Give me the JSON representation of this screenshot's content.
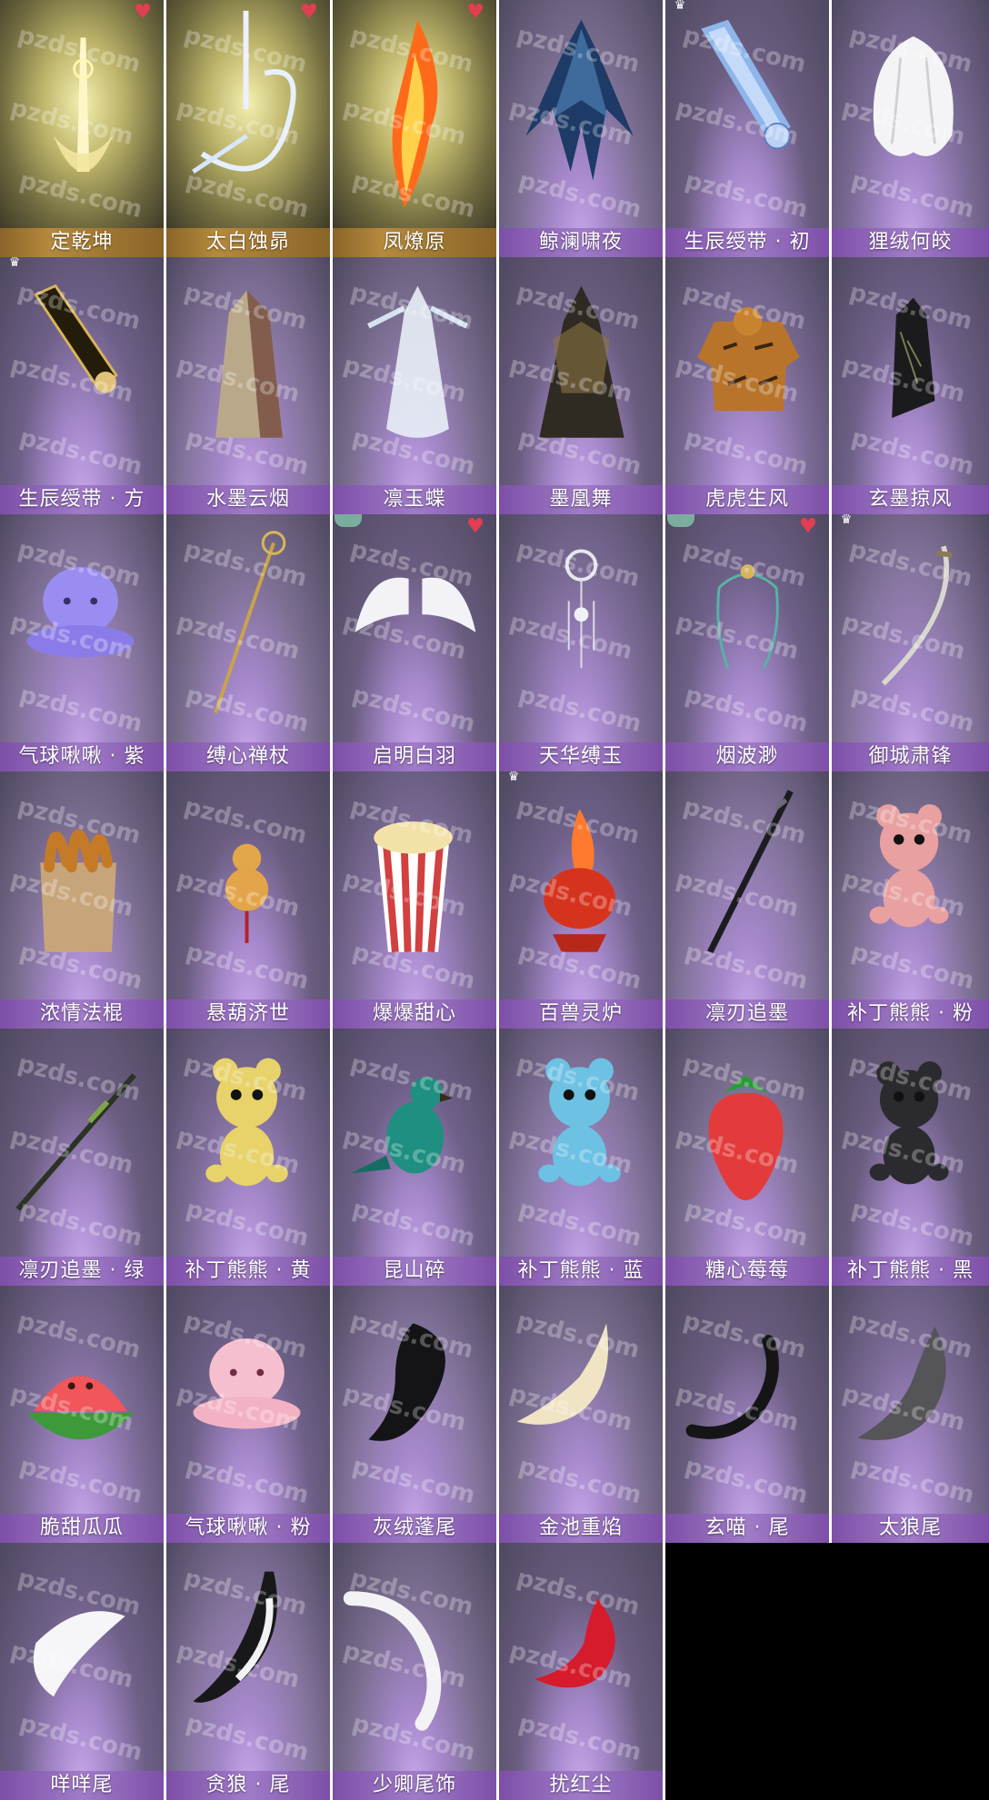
{
  "grid": {
    "items": [
      {
        "label": "定乾坤",
        "scene": "gold",
        "art": "sword-gold",
        "badge": "heart"
      },
      {
        "label": "太白蚀昴",
        "scene": "gold",
        "art": "sword-silver",
        "badge": "heart"
      },
      {
        "label": "凤燎原",
        "scene": "gold",
        "art": "flame-blade",
        "badge": "heart"
      },
      {
        "label": "鲸澜啸夜",
        "scene": "purple",
        "art": "dark-cape",
        "badge": ""
      },
      {
        "label": "生辰绶带 · 初",
        "scene": "purple",
        "art": "blue-sash",
        "badge": "crown"
      },
      {
        "label": "狸绒何皎",
        "scene": "purple",
        "art": "white-fur",
        "badge": ""
      },
      {
        "label": "生辰绶带 · 方",
        "scene": "purple",
        "art": "gold-sash",
        "badge": "crown"
      },
      {
        "label": "水墨云烟",
        "scene": "purple",
        "art": "robe-beige",
        "badge": ""
      },
      {
        "label": "凛玉蝶",
        "scene": "purple",
        "art": "white-dress",
        "badge": ""
      },
      {
        "label": "墨凰舞",
        "scene": "purple",
        "art": "dark-gown",
        "badge": ""
      },
      {
        "label": "虎虎生风",
        "scene": "purple",
        "art": "tiger-hoodie",
        "badge": ""
      },
      {
        "label": "玄墨掠风",
        "scene": "purple",
        "art": "black-cloak",
        "badge": ""
      },
      {
        "label": "气球啾啾 · 紫",
        "scene": "purple",
        "art": "balloon-purple",
        "badge": ""
      },
      {
        "label": "缚心禅杖",
        "scene": "purple",
        "art": "staff-gold",
        "badge": ""
      },
      {
        "label": "启明白羽",
        "scene": "purple",
        "art": "white-wings",
        "badge": "heart-leaf"
      },
      {
        "label": "天华缚玉",
        "scene": "purple",
        "art": "jade-pendant",
        "badge": ""
      },
      {
        "label": "烟波渺",
        "scene": "purple",
        "art": "teal-ribbon",
        "badge": "heart-leaf"
      },
      {
        "label": "御城肃锋",
        "scene": "purple",
        "art": "curved-blade",
        "badge": "crown"
      },
      {
        "label": "浓情法棍",
        "scene": "purple",
        "art": "baguette-bag",
        "badge": ""
      },
      {
        "label": "悬葫济世",
        "scene": "purple",
        "art": "gourd",
        "badge": ""
      },
      {
        "label": "爆爆甜心",
        "scene": "purple",
        "art": "popcorn",
        "badge": ""
      },
      {
        "label": "百兽灵炉",
        "scene": "purple",
        "art": "red-censer",
        "badge": "crown"
      },
      {
        "label": "凛刃追墨",
        "scene": "purple",
        "art": "dark-sword",
        "badge": ""
      },
      {
        "label": "补丁熊熊 · 粉",
        "scene": "purple",
        "art": "bear-pink",
        "badge": ""
      },
      {
        "label": "凛刃追墨 · 绿",
        "scene": "purple",
        "art": "green-sword",
        "badge": ""
      },
      {
        "label": "补丁熊熊 · 黄",
        "scene": "purple",
        "art": "bear-yellow",
        "badge": ""
      },
      {
        "label": "昆山碎",
        "scene": "purple",
        "art": "teal-bird",
        "badge": ""
      },
      {
        "label": "补丁熊熊 · 蓝",
        "scene": "purple",
        "art": "bear-blue",
        "badge": ""
      },
      {
        "label": "糖心莓莓",
        "scene": "purple",
        "art": "strawberry",
        "badge": ""
      },
      {
        "label": "补丁熊熊 · 黑",
        "scene": "purple",
        "art": "bear-black",
        "badge": ""
      },
      {
        "label": "脆甜瓜瓜",
        "scene": "purple",
        "art": "watermelon",
        "badge": ""
      },
      {
        "label": "气球啾啾 · 粉",
        "scene": "purple",
        "art": "balloon-pink",
        "badge": ""
      },
      {
        "label": "灰绒蓬尾",
        "scene": "purple",
        "art": "tail-black-fluffy",
        "badge": ""
      },
      {
        "label": "金池重焰",
        "scene": "purple",
        "art": "tail-cream",
        "badge": ""
      },
      {
        "label": "玄喵 · 尾",
        "scene": "purple",
        "art": "tail-cat-black",
        "badge": ""
      },
      {
        "label": "太狼尾",
        "scene": "purple",
        "art": "tail-wolf-grey",
        "badge": ""
      },
      {
        "label": "咩咩尾",
        "scene": "purple",
        "art": "tail-white-fluff",
        "badge": ""
      },
      {
        "label": "贪狼 · 尾",
        "scene": "purple",
        "art": "tail-bw",
        "badge": ""
      },
      {
        "label": "少卿尾饰",
        "scene": "purple",
        "art": "tail-white-long",
        "badge": ""
      },
      {
        "label": "扰红尘",
        "scene": "purple",
        "art": "tail-red",
        "badge": ""
      }
    ]
  },
  "watermark": "pzds.com",
  "colors": {
    "gold_label": "#a27a35",
    "purple_label": "#9873c2",
    "heart": "#e23e52"
  }
}
